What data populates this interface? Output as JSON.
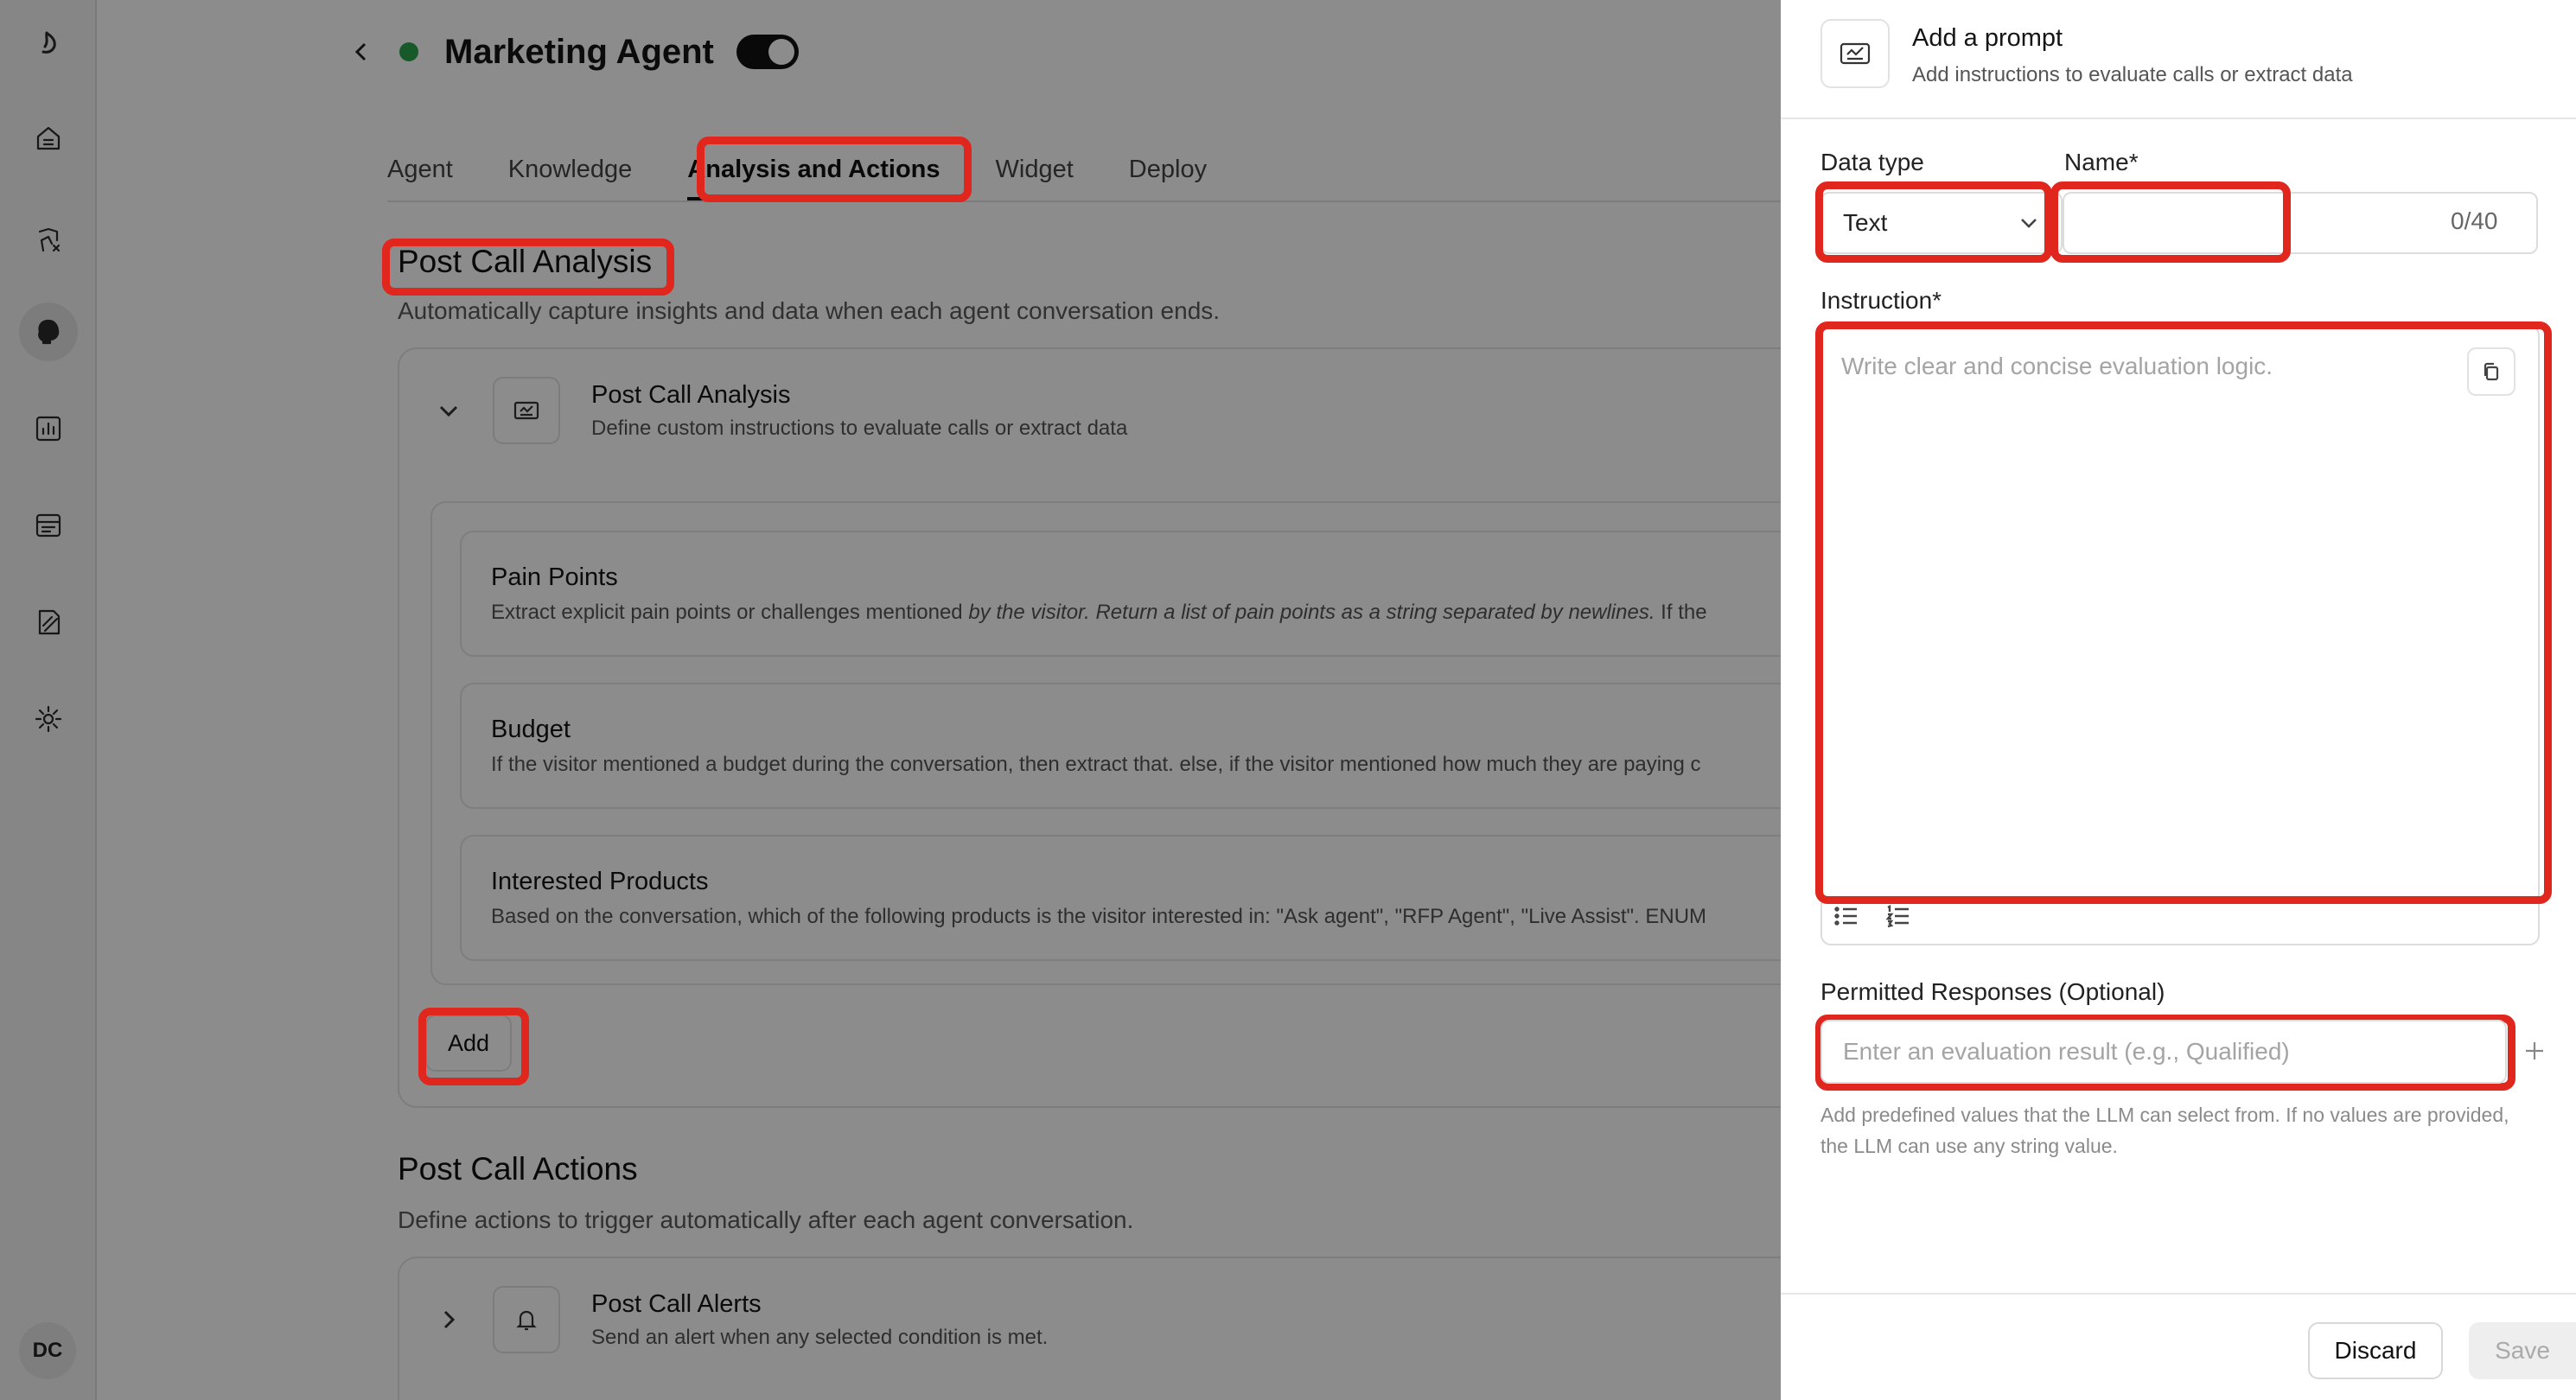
{
  "sidebar": {
    "icons": [
      "logo-icon",
      "home-icon",
      "agents-icon",
      "brain-icon",
      "analytics-icon",
      "inbox-icon",
      "docs-icon",
      "settings-icon"
    ],
    "user_initials": "DC"
  },
  "header": {
    "title": "Marketing Agent",
    "status": "active",
    "enabled": true
  },
  "tabs": [
    {
      "label": "Agent"
    },
    {
      "label": "Knowledge"
    },
    {
      "label": "Analysis and Actions",
      "active": true
    },
    {
      "label": "Widget"
    },
    {
      "label": "Deploy"
    }
  ],
  "post_call_analysis": {
    "title": "Post Call Analysis",
    "subtitle": "Automatically capture insights and data when each agent conversation ends.",
    "card": {
      "title": "Post Call Analysis",
      "subtitle": "Define custom instructions to evaluate calls or extract data"
    },
    "items": [
      {
        "title": "Pain Points",
        "description_plain": "Extract explicit pain points or challenges mentioned ",
        "description_italic": "by the visitor. Return a list of pain points as a string separated by newlines.",
        "description_tail": " If the"
      },
      {
        "title": "Budget",
        "description": "If the visitor mentioned a budget during the conversation, then extract that. else, if the visitor mentioned how much they are paying c"
      },
      {
        "title": "Interested Products",
        "description": "Based on the conversation, which of the following products is the visitor interested in: \"Ask agent\", \"RFP Agent\", \"Live Assist\". ENUM"
      }
    ],
    "add_label": "Add"
  },
  "post_call_actions": {
    "title": "Post Call Actions",
    "subtitle": "Define actions to trigger automatically after each agent conversation.",
    "card": {
      "title": "Post Call Alerts",
      "subtitle": "Send an alert when any selected condition is met."
    }
  },
  "drawer": {
    "title": "Add a prompt",
    "subtitle": "Add instructions to evaluate calls or extract data",
    "data_type_label": "Data type",
    "data_type_value": "Text",
    "name_label": "Name*",
    "name_value": "",
    "name_counter": "0/40",
    "instruction_label": "Instruction*",
    "instruction_placeholder": "Write clear and concise evaluation logic.",
    "permitted_label": "Permitted Responses (Optional)",
    "permitted_placeholder": "Enter an evaluation result (e.g., Qualified)",
    "help_text": "Add predefined values that the LLM can select from. If no values are provided, the LLM can use any string value.",
    "discard_label": "Discard",
    "save_label": "Save"
  },
  "colors": {
    "highlight": "#e0261d",
    "status_green": "#2aa24a",
    "overlay": "rgba(0,0,0,0.45)"
  }
}
